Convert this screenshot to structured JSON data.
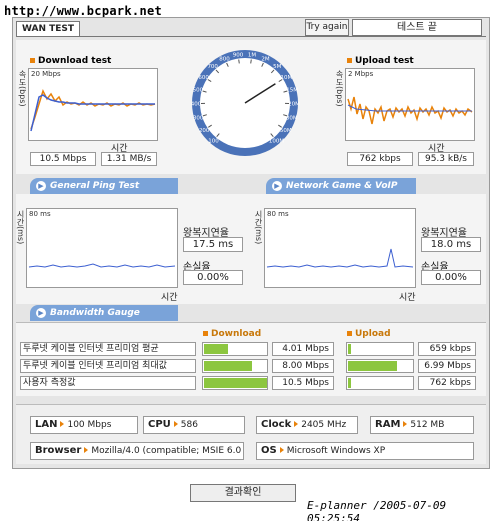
{
  "watermark": "http://www.bcpark.net",
  "header": {
    "tab": "WAN TEST",
    "try_again": "Try again",
    "status": "테스트 끝"
  },
  "download": {
    "title": "Download test",
    "scale": "20 Mbps",
    "ylabel": "속도(bps)",
    "xlabel": "시간",
    "speed": "10.5 Mbps",
    "rate": "1.31 MB/s"
  },
  "upload": {
    "title": "Upload test",
    "scale": "2 Mbps",
    "ylabel": "속도(bps)",
    "xlabel": "시간",
    "speed": "762 kbps",
    "rate": "95.3 kB/s"
  },
  "gauge": {
    "ticks": [
      "100",
      "200",
      "300",
      "400",
      "500",
      "600",
      "700",
      "800",
      "900",
      "1M",
      "2M",
      "5M",
      "10M",
      "15M",
      "20M",
      "30M",
      "50M",
      "100M"
    ],
    "needle_value": "10M"
  },
  "ping": {
    "title": "General Ping Test",
    "scale": "80 ms",
    "ylabel": "시간(ms)",
    "xlabel": "시간",
    "rtt_label": "왕복지연율",
    "rtt": "17.5 ms",
    "loss_label": "손실율",
    "loss": "0.00%"
  },
  "game": {
    "title": "Network Game & VoIP Test",
    "scale": "80 ms",
    "ylabel": "시간(ms)",
    "xlabel": "시간",
    "rtt_label": "왕복지연율",
    "rtt": "18.0 ms",
    "loss_label": "손실율",
    "loss": "0.00%"
  },
  "bandwidth": {
    "title": "Bandwidth Gauge",
    "download_header": "Download",
    "upload_header": "Upload",
    "rows": [
      {
        "label": "두루넷 케이블 인터넷 프리미엄 평균",
        "down": "4.01 Mbps",
        "down_fill": 0.38,
        "up": "659 kbps",
        "up_fill": 0.04
      },
      {
        "label": "두루넷 케이블 인터넷 프리미엄 최대값",
        "down": "8.00 Mbps",
        "down_fill": 0.76,
        "up": "6.99 Mbps",
        "up_fill": 0.75
      },
      {
        "label": "사용자 측정값",
        "down": "10.5 Mbps",
        "down_fill": 1.0,
        "up": "762 kbps",
        "up_fill": 0.05
      }
    ]
  },
  "system": {
    "lan_label": "LAN",
    "lan": "100 Mbps",
    "cpu_label": "CPU",
    "cpu": "586",
    "clock_label": "Clock",
    "clock": "2405 MHz",
    "ram_label": "RAM",
    "ram": "512 MB",
    "browser_label": "Browser",
    "browser": "Mozilla/4.0 (compatible; MSIE 6.0",
    "os_label": "OS",
    "os": "Microsoft Windows XP"
  },
  "confirm_button": "결과확인",
  "footer": "E-planner /2005-07-09 05:25:54",
  "colors": {
    "download_line": "#3c5fd1",
    "download_line2": "#e8820a",
    "ping_line": "#3c5fd1",
    "pill": "#7aa3d9",
    "bar_fill": "#8cc63f",
    "accent": "#e8820a"
  }
}
